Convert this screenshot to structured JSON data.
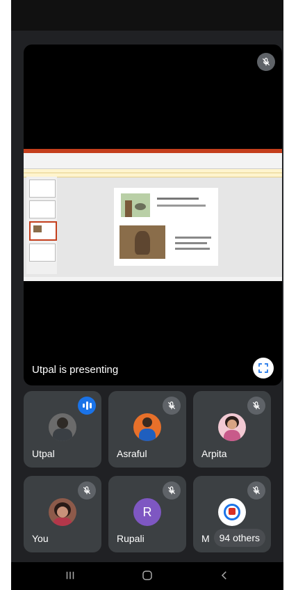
{
  "presentation": {
    "presenter_label": "Utpal is presenting"
  },
  "participants": [
    {
      "name": "Utpal",
      "status": "speaking"
    },
    {
      "name": "Asraful",
      "status": "muted"
    },
    {
      "name": "Arpita",
      "status": "muted"
    },
    {
      "name": "You",
      "status": "muted"
    },
    {
      "name": "Rupali",
      "status": "muted",
      "initial": "R",
      "avatar_color": "#7e57c2"
    },
    {
      "name": "M",
      "status": "muted"
    }
  ],
  "others": {
    "label": "94 others"
  },
  "colors": {
    "background": "#202124",
    "tile": "#3c4043",
    "speaking": "#1a73e8"
  }
}
